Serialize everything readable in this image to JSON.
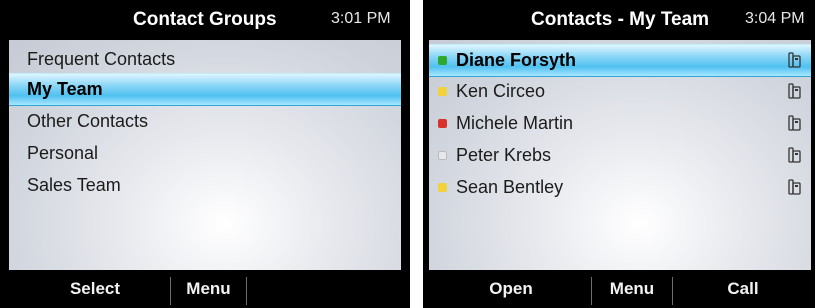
{
  "left_screen": {
    "title": "Contact Groups",
    "time": "3:01 PM",
    "groups": [
      {
        "label": "Frequent Contacts",
        "selected": false
      },
      {
        "label": "My Team",
        "selected": true
      },
      {
        "label": "Other Contacts",
        "selected": false
      },
      {
        "label": "Personal",
        "selected": false
      },
      {
        "label": "Sales Team",
        "selected": false
      }
    ],
    "softkeys": [
      "Select",
      "Menu"
    ]
  },
  "right_screen": {
    "title": "Contacts - My Team",
    "time": "3:04 PM",
    "contacts": [
      {
        "name": "Diane Forsyth",
        "presence_color": "#2fa82f",
        "icon": "desk-phone-icon",
        "selected": true
      },
      {
        "name": "Ken Circeo",
        "presence_color": "#f2d13a",
        "icon": "desk-phone-icon",
        "selected": false
      },
      {
        "name": "Michele Martin",
        "presence_color": "#d9302c",
        "icon": "desk-phone-icon",
        "selected": false
      },
      {
        "name": "Peter Krebs",
        "presence_color": "#e6e8ec",
        "icon": "desk-phone-icon",
        "selected": false
      },
      {
        "name": "Sean Bentley",
        "presence_color": "#f2d13a",
        "icon": "desk-phone-icon",
        "selected": false
      }
    ],
    "softkeys": [
      "Open",
      "Menu",
      "Call"
    ]
  }
}
